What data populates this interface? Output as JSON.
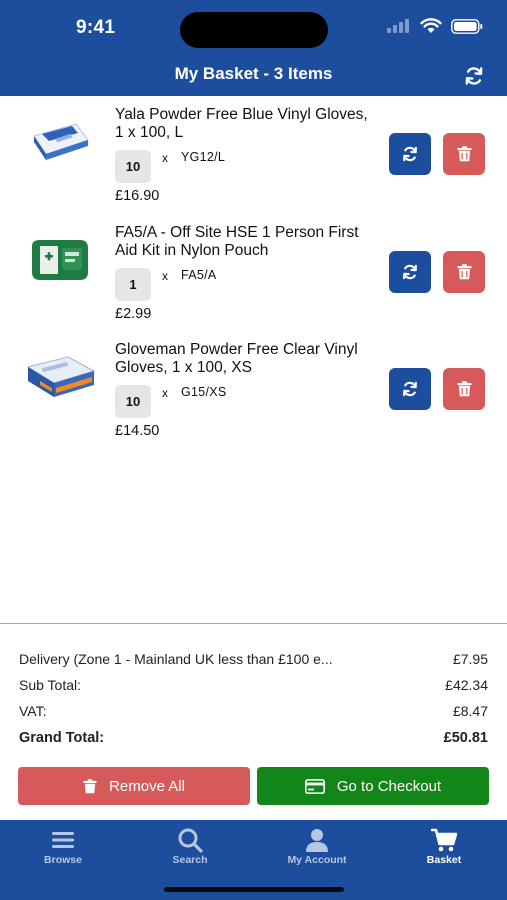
{
  "status_bar": {
    "time": "9:41"
  },
  "nav": {
    "title": "My Basket - 3 Items",
    "refresh_icon": "refresh-icon"
  },
  "items": [
    {
      "name": "Yala Powder Free Blue Vinyl Gloves, 1 x 100, L",
      "quantity": "10",
      "times": "x",
      "sku": "YG12/L",
      "price": "£16.90"
    },
    {
      "name": "FA5/A - Off Site HSE 1 Person First Aid Kit in Nylon Pouch",
      "quantity": "1",
      "times": "x",
      "sku": "FA5/A",
      "price": "£2.99"
    },
    {
      "name": "Gloveman Powder Free Clear Vinyl Gloves, 1 x 100, XS",
      "quantity": "10",
      "times": "x",
      "sku": "G15/XS",
      "price": "£14.50"
    }
  ],
  "summary": {
    "delivery_label": "Delivery (Zone 1 - Mainland UK less than £100 e...",
    "delivery_value": "£7.95",
    "subtotal_label": "Sub Total:",
    "subtotal_value": "£42.34",
    "vat_label": "VAT:",
    "vat_value": "£8.47",
    "grand_total_label": "Grand Total:",
    "grand_total_value": "£50.81"
  },
  "actions": {
    "remove_all": "Remove All",
    "checkout": "Go to Checkout"
  },
  "tabs": [
    {
      "label": "Browse",
      "icon": "menu-icon"
    },
    {
      "label": "Search",
      "icon": "search-icon"
    },
    {
      "label": "My Account",
      "icon": "account-icon"
    },
    {
      "label": "Basket",
      "icon": "cart-icon",
      "active": true
    }
  ],
  "colors": {
    "brand_blue": "#1d4e9e",
    "delete_red": "#d65a5a",
    "checkout_green": "#13861a"
  }
}
